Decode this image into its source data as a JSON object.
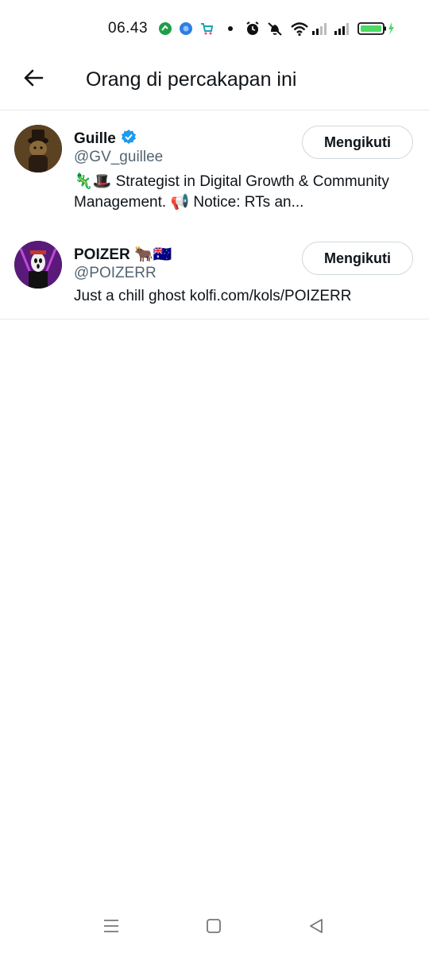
{
  "status_bar": {
    "time": "06.43",
    "icons": [
      "app-notification-icon",
      "app-notification-icon",
      "shopping-cart-icon",
      "dot-icon",
      "alarm-icon",
      "vibrate-off-icon",
      "wifi-icon",
      "signal-icon",
      "signal-icon",
      "battery-charging-icon"
    ],
    "battery_color": "#4cd964"
  },
  "header": {
    "title": "Orang di percakapan ini",
    "back_icon": "arrow-left-icon"
  },
  "users": [
    {
      "name": "Guille",
      "verified": true,
      "handle": "@GV_guillee",
      "bio": "🦎🎩 Strategist in Digital Growth & Community Management. 📢 Notice: RTs an...",
      "follow_label": "Mengikuti"
    },
    {
      "name": "POIZER 🐂🇦🇺",
      "verified": false,
      "handle": "@POIZERR",
      "bio": "Just a chill ghost  kolfi.com/kols/POIZERR",
      "follow_label": "Mengikuti"
    }
  ],
  "nav_bar": {
    "icons": [
      "menu-icon",
      "home-square-icon",
      "back-triangle-icon"
    ]
  },
  "colors": {
    "verified_badge": "#1d9bf0",
    "handle_text": "#536471",
    "divider": "#e6e9eb"
  }
}
